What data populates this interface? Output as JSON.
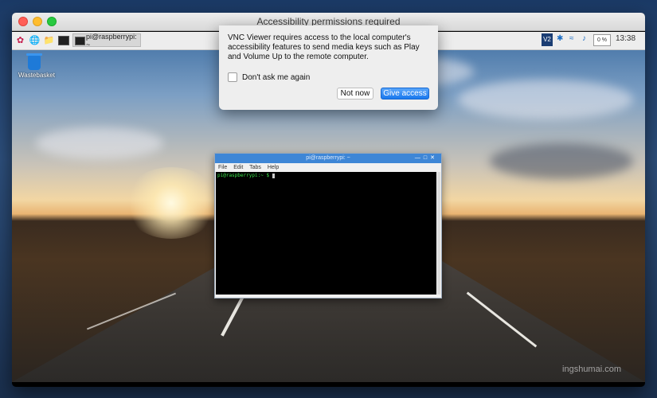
{
  "mac_window": {
    "title": "Accessibility permissions required"
  },
  "remote_taskbar": {
    "task_label": "pi@raspberrypi: ~",
    "tray_vnc": "V2",
    "tray_cpu": "0 %",
    "clock": "13:38"
  },
  "desktop": {
    "wastebasket_label": "Wastebasket",
    "watermark": "ingshumai.com"
  },
  "terminal": {
    "title": "pi@raspberrypi: ~",
    "menu": [
      "File",
      "Edit",
      "Tabs",
      "Help"
    ],
    "prompt": "pi@raspberrypi:~ $ "
  },
  "dialog": {
    "message": "VNC Viewer requires access to the local computer's accessibility features to send media keys such as Play and Volume Up to the remote computer.",
    "checkbox_label": "Don't ask me again",
    "checkbox_checked": false,
    "not_now_label": "Not now",
    "give_access_label": "Give access"
  },
  "colors": {
    "accent": "#1a78ee",
    "terminal_titlebar": "#3e86d6",
    "prompt_green": "#3ae34a"
  }
}
